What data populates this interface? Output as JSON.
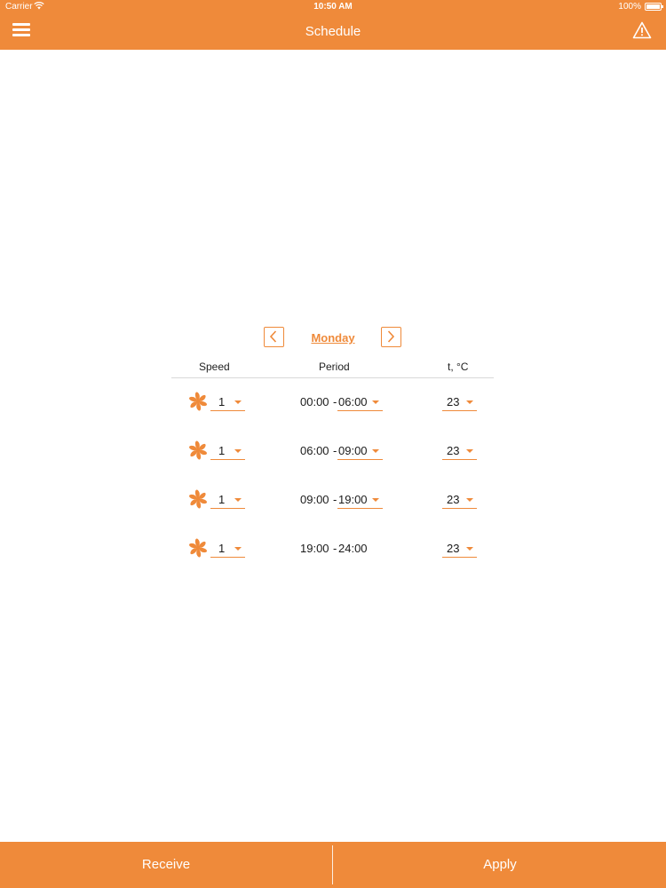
{
  "status_bar": {
    "carrier": "Carrier",
    "time": "10:50 AM",
    "battery": "100%"
  },
  "header": {
    "title": "Schedule",
    "menu_icon": "hamburger-menu-icon",
    "warning_icon": "warning-triangle-icon"
  },
  "day_nav": {
    "day": "Monday"
  },
  "columns": {
    "speed": "Speed",
    "period": "Period",
    "temp": "t, °C"
  },
  "rows": [
    {
      "speed": "1",
      "start": "00:00",
      "separator": "-",
      "end": "06:00",
      "temp": "23"
    },
    {
      "speed": "1",
      "start": "06:00",
      "separator": "-",
      "end": "09:00",
      "temp": "23"
    },
    {
      "speed": "1",
      "start": "09:00",
      "separator": "-",
      "end": "19:00",
      "temp": "23"
    },
    {
      "speed": "1",
      "start": "19:00",
      "separator": "-",
      "end": "24:00",
      "temp": "23"
    }
  ],
  "footer": {
    "receive_label": "Receive",
    "apply_label": "Apply"
  },
  "colors": {
    "accent": "#ef8a3a"
  }
}
